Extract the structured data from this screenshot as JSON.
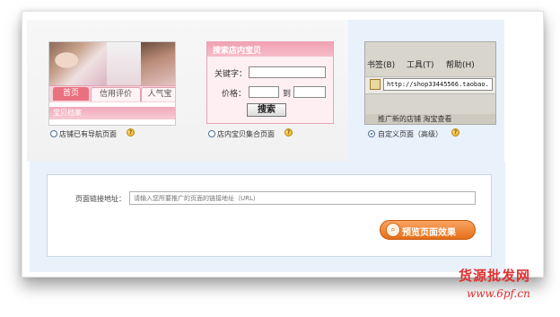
{
  "options": [
    {
      "label": "店铺已有导航页面",
      "selected": false,
      "help": "?"
    },
    {
      "label": "店内宝贝集合页面",
      "selected": false,
      "help": "?"
    },
    {
      "label": "自定义页面（高级）",
      "selected": true,
      "help": "?"
    }
  ],
  "thumb_nav": {
    "tabs": [
      "首页",
      "信用评价",
      "人气宝"
    ],
    "sub_label": "宝贝档案"
  },
  "thumb_search": {
    "title": "搜索店内宝贝",
    "keyword_label": "关键字：",
    "price_label": "价格：",
    "to_label": "到",
    "search_button": "搜索"
  },
  "thumb_custom": {
    "menu": [
      "书签(B)",
      "工具(T)",
      "帮助(H)"
    ],
    "url": "http://shop33445566.taobao.",
    "bottom_text": "推广新的店铺  淘宝查看"
  },
  "form": {
    "url_label": "页面链接地址：",
    "url_placeholder": "请输入您所要推广的页面的链接地址（URL）",
    "preview_button": "预览页面效果",
    "preview_icon": "magnifier-icon"
  },
  "watermark": {
    "line1": "货源批发网",
    "line2": "www.6pf.cn"
  },
  "colors": {
    "accent_orange": "#e66f18",
    "panel_blue": "#e9f1fb",
    "pink": "#f2a2b3"
  }
}
